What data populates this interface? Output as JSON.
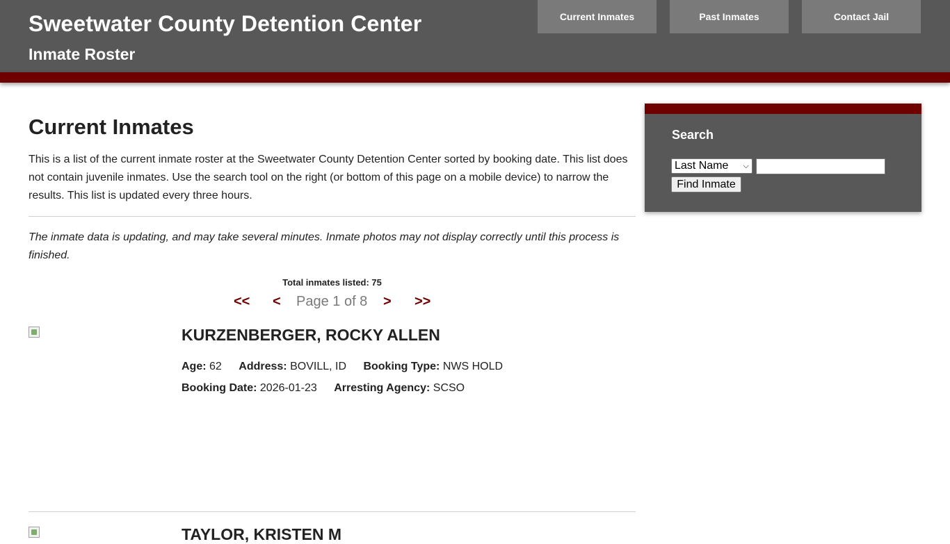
{
  "header": {
    "title": "Sweetwater County Detention Center",
    "subtitle": "Inmate Roster",
    "nav": [
      "Current Inmates",
      "Past Inmates",
      "Contact Jail"
    ]
  },
  "main": {
    "title": "Current Inmates",
    "intro": "This is a list of the current inmate roster at the Sweetwater County Detention Center sorted by booking date. This list does not contain juvenile inmates. Use the search tool on the right (or bottom of this page on a mobile device) to narrow the results. This list is updated every three hours.",
    "notice": "The inmate data is updating, and may take several minutes. Inmate photos may not display correctly until this process is finished.",
    "total": "Total inmates listed: 75",
    "pager": {
      "first": "<<",
      "prev": "<",
      "label": "Page 1 of 8",
      "next": ">",
      "last": ">>"
    },
    "inmates": [
      {
        "name": "KURZENBERGER, ROCKY ALLEN",
        "age_label": "Age:",
        "age": "62",
        "address_label": "Address:",
        "address": "BOVILL, ID",
        "booking_type_label": "Booking Type:",
        "booking_type": "NWS HOLD",
        "booking_date_label": "Booking Date:",
        "booking_date": "2026-01-23",
        "agency_label": "Arresting Agency:",
        "agency": "SCSO"
      },
      {
        "name": "TAYLOR, KRISTEN M"
      }
    ]
  },
  "sidebar": {
    "heading": "Search",
    "select_value": "Last Name",
    "input_value": "",
    "button": "Find Inmate"
  },
  "colors": {
    "header_bg": "#585858",
    "accent": "#6e0000",
    "nav_button": "#7a7a7a"
  }
}
